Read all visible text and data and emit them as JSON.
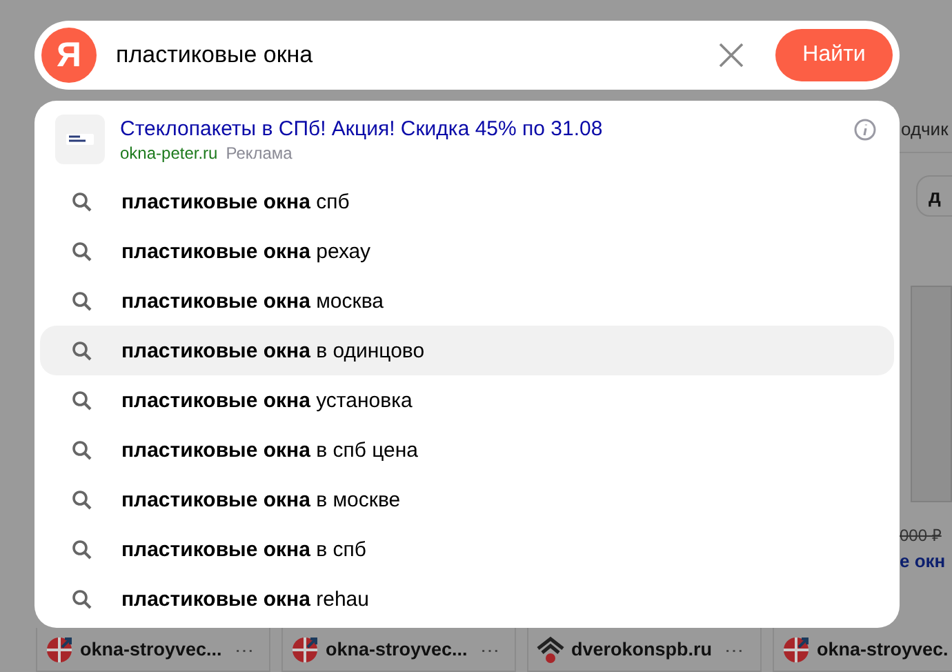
{
  "search": {
    "logo": "Я",
    "query": "пластиковые окна ",
    "button": "Найти"
  },
  "ad": {
    "title": "Стеклопакеты в СПб! Акция! Скидка 45% по 31.08",
    "url": "okna-peter.ru",
    "label": "Реклама"
  },
  "suggestions": [
    {
      "text": "**пластиковые окна** спб",
      "selected": false
    },
    {
      "text": "**пластиковые окна** рехау",
      "selected": false
    },
    {
      "text": "**пластиковые окна** москва",
      "selected": false
    },
    {
      "text": "**пластиковые окна** в одинцово",
      "selected": true
    },
    {
      "text": "**пластиковые окна** установка",
      "selected": false
    },
    {
      "text": "**пластиковые окна** в спб цена",
      "selected": false
    },
    {
      "text": "**пластиковые окна** в москве",
      "selected": false
    },
    {
      "text": "**пластиковые окна** в спб",
      "selected": false
    },
    {
      "text": "**пластиковые окна** rehau",
      "selected": false
    }
  ],
  "background": {
    "tab": "одчик",
    "chip": "д",
    "old_price": "000 ₽",
    "product_title": "е окн"
  },
  "result_sources": [
    {
      "site": "okna-stroyvec...",
      "more": "⋯",
      "kind": "cross"
    },
    {
      "site": "okna-stroyvec...",
      "more": "⋯",
      "kind": "cross"
    },
    {
      "site": "dverokonspb.ru",
      "more": "⋯",
      "kind": "house"
    },
    {
      "site": "okna-stroyvec.",
      "kind": "cross"
    }
  ]
}
